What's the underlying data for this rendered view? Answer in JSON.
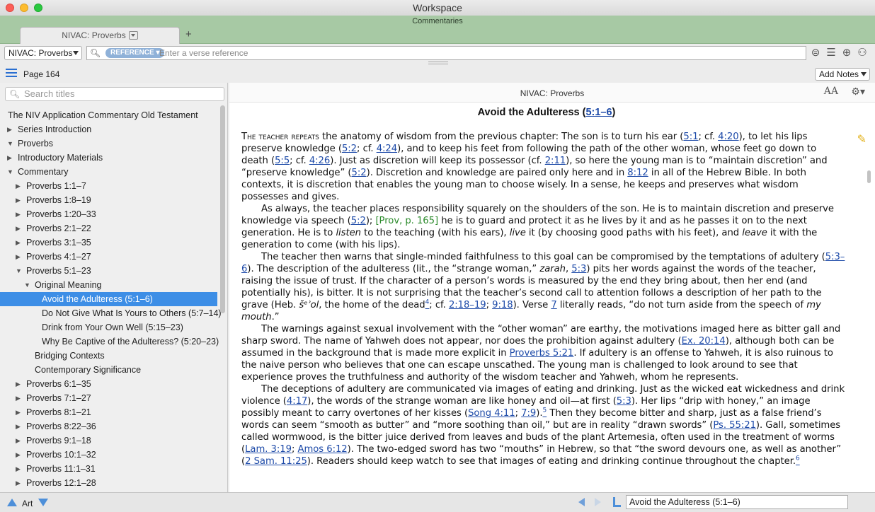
{
  "window": {
    "title": "Workspace"
  },
  "panel": {
    "title": "Commentaries",
    "tab_label": "NIVAC: Proverbs",
    "add_tab": "+"
  },
  "toolbar": {
    "resource": "NIVAC: Proverbs",
    "reference_pill": "REFERENCE ▾",
    "search_placeholder": "Enter a verse reference",
    "icons": [
      "search-options-icon",
      "list-icon",
      "add-icon",
      "people-icon"
    ]
  },
  "pagebar": {
    "page": "Page 164",
    "add_notes": "Add Notes"
  },
  "sidebar": {
    "search_placeholder": "Search titles",
    "items": [
      {
        "label": "The NIV Application Commentary Old Testament",
        "level": 0,
        "toggle": ""
      },
      {
        "label": "Series Introduction",
        "level": 1,
        "toggle": "▶"
      },
      {
        "label": "Proverbs",
        "level": 1,
        "toggle": "▼"
      },
      {
        "label": "Introductory Materials",
        "level": 2,
        "toggle": "▶"
      },
      {
        "label": "Commentary",
        "level": 2,
        "toggle": "▼"
      },
      {
        "label": "Proverbs 1:1–7",
        "level": 3,
        "toggle": "▶"
      },
      {
        "label": "Proverbs 1:8–19",
        "level": 3,
        "toggle": "▶"
      },
      {
        "label": "Proverbs 1:20–33",
        "level": 3,
        "toggle": "▶"
      },
      {
        "label": "Proverbs 2:1–22",
        "level": 3,
        "toggle": "▶"
      },
      {
        "label": "Proverbs 3:1–35",
        "level": 3,
        "toggle": "▶"
      },
      {
        "label": "Proverbs 4:1–27",
        "level": 3,
        "toggle": "▶"
      },
      {
        "label": "Proverbs 5:1–23",
        "level": 3,
        "toggle": "▼"
      },
      {
        "label": "Original Meaning",
        "level": 4,
        "toggle": "▼"
      },
      {
        "label": "Avoid the Adulteress (5:1–6)",
        "level": 5,
        "toggle": "",
        "selected": true
      },
      {
        "label": "Do Not Give What Is Yours to Others (5:7–14)",
        "level": 5,
        "toggle": ""
      },
      {
        "label": "Drink from Your Own Well (5:15–23)",
        "level": 5,
        "toggle": ""
      },
      {
        "label": "Why Be Captive of the Adulteress?  (5:20–23)",
        "level": 5,
        "toggle": ""
      },
      {
        "label": "Bridging Contexts",
        "level": 4,
        "toggle": ""
      },
      {
        "label": "Contemporary Significance",
        "level": 4,
        "toggle": ""
      },
      {
        "label": "Proverbs 6:1–35",
        "level": 3,
        "toggle": "▶"
      },
      {
        "label": "Proverbs 7:1–27",
        "level": 3,
        "toggle": "▶"
      },
      {
        "label": "Proverbs 8:1–21",
        "level": 3,
        "toggle": "▶"
      },
      {
        "label": "Proverbs 8:22–36",
        "level": 3,
        "toggle": "▶"
      },
      {
        "label": "Proverbs 9:1–18",
        "level": 3,
        "toggle": "▶"
      },
      {
        "label": "Proverbs 10:1–32",
        "level": 3,
        "toggle": "▶"
      },
      {
        "label": "Proverbs 11:1–31",
        "level": 3,
        "toggle": "▶"
      },
      {
        "label": "Proverbs 12:1–28",
        "level": 3,
        "toggle": "▶"
      }
    ]
  },
  "content": {
    "resource_name": "NIVAC: Proverbs",
    "font_size_icon": "AA",
    "heading_text": "Avoid the Adulteress (",
    "heading_ref": "5:1–6",
    "heading_close": ")",
    "paragraphs": [
      [
        {
          "t": "The teacher repeats",
          "c": "sc"
        },
        {
          "t": " the anatomy of wisdom from the previous chapter: The son is to turn his ear ("
        },
        {
          "t": "5:1",
          "c": "ref"
        },
        {
          "t": "; cf. "
        },
        {
          "t": "4:20",
          "c": "ref"
        },
        {
          "t": "), to let his lips preserve knowledge ("
        },
        {
          "t": "5:2",
          "c": "ref"
        },
        {
          "t": "; cf. "
        },
        {
          "t": "4:24",
          "c": "ref"
        },
        {
          "t": "), and to keep his feet from following the path of the other woman, whose feet go down to death ("
        },
        {
          "t": "5:5",
          "c": "ref"
        },
        {
          "t": "; cf. "
        },
        {
          "t": "4:26",
          "c": "ref"
        },
        {
          "t": "). Just as discretion will keep its possessor (cf. "
        },
        {
          "t": "2:11",
          "c": "ref"
        },
        {
          "t": "), so here the young man is to “maintain discretion” and “preserve knowledge” ("
        },
        {
          "t": "5:2",
          "c": "ref"
        },
        {
          "t": "). Discretion and knowledge are paired only here and in "
        },
        {
          "t": "8:12",
          "c": "ref"
        },
        {
          "t": " in all of the Hebrew Bible. In both contexts, it is discretion that enables the young man to choose wisely. In a sense, he keeps and preserves what wisdom possesses and gives."
        }
      ],
      [
        {
          "t": "As always, the teacher places responsibility squarely on the shoulders of the son. He is to maintain discretion and preserve knowledge via speech ("
        },
        {
          "t": "5:2",
          "c": "ref"
        },
        {
          "t": "); "
        },
        {
          "t": "[Prov, p. 165]",
          "c": "green"
        },
        {
          "t": " he is to guard and protect it as he lives by it and as he passes it on to the next generation. He is to "
        },
        {
          "t": "listen",
          "c": "i"
        },
        {
          "t": " to the teaching (with his ears), "
        },
        {
          "t": "live",
          "c": "i"
        },
        {
          "t": " it (by choosing good paths with his feet), and "
        },
        {
          "t": "leave",
          "c": "i"
        },
        {
          "t": " it with the generation to come (with his lips)."
        }
      ],
      [
        {
          "t": "The teacher then warns that single-minded faithfulness to this goal can be compromised by the temptations of adultery ("
        },
        {
          "t": "5:3–6",
          "c": "ref"
        },
        {
          "t": "). The description of the adulteress (lit., the “strange woman,” "
        },
        {
          "t": "zarah",
          "c": "i"
        },
        {
          "t": ", "
        },
        {
          "t": "5:3",
          "c": "ref"
        },
        {
          "t": ") pits her words against the words of the teacher, raising the issue of trust. If the character of a person’s words is measured by the end they bring about, then her end (and potentially his), is bitter. It is not surprising that the teacher’s second call to attention follows a description of her path to the grave (Heb. "
        },
        {
          "t": "šᵉʾol",
          "c": "i"
        },
        {
          "t": ", the home of the dead"
        },
        {
          "t": "4",
          "c": "supref"
        },
        {
          "t": "; cf. "
        },
        {
          "t": "2:18–19",
          "c": "ref"
        },
        {
          "t": "; "
        },
        {
          "t": "9:18",
          "c": "ref"
        },
        {
          "t": "). Verse "
        },
        {
          "t": "7",
          "c": "ref"
        },
        {
          "t": " literally reads, “do not turn aside from the speech of "
        },
        {
          "t": "my mouth",
          "c": "i"
        },
        {
          "t": ".”"
        }
      ],
      [
        {
          "t": "The warnings against sexual involvement with the “other woman” are earthy, the motivations imaged here as bitter gall and sharp sword. The name of Yahweh does not appear, nor does the prohibition against adultery ("
        },
        {
          "t": "Ex. 20:14",
          "c": "ref"
        },
        {
          "t": "), although both can be assumed in the background that is made more explicit in "
        },
        {
          "t": "Proverbs 5:21",
          "c": "ref"
        },
        {
          "t": ". If adultery is an offense to Yahweh, it is also ruinous to the naive person who believes that one can escape unscathed. The young man is challenged to look around to see that experience proves the truthfulness and authority of the wisdom teacher and Yahweh, whom he represents."
        }
      ],
      [
        {
          "t": "The deceptions of adultery are communicated via images of eating and drinking. Just as the wicked eat wickedness and drink violence ("
        },
        {
          "t": "4:17",
          "c": "ref"
        },
        {
          "t": "), the words of the strange woman are like honey and oil—at first ("
        },
        {
          "t": "5:3",
          "c": "ref"
        },
        {
          "t": "). Her lips “drip with honey,” an image possibly meant to carry overtones of her kisses ("
        },
        {
          "t": "Song 4:11",
          "c": "ref"
        },
        {
          "t": "; "
        },
        {
          "t": "7:9",
          "c": "ref"
        },
        {
          "t": ")."
        },
        {
          "t": "5",
          "c": "supref"
        },
        {
          "t": " Then they become bitter and sharp, just as a false friend’s words can seem “smooth as butter” and “more soothing than oil,” but are in reality “drawn swords” ("
        },
        {
          "t": "Ps. 55:21",
          "c": "ref"
        },
        {
          "t": "). Gall, sometimes called wormwood, is the bitter juice derived from leaves and buds of the plant Artemesia, often used in the treatment of worms ("
        },
        {
          "t": "Lam. 3:19",
          "c": "ref"
        },
        {
          "t": "; "
        },
        {
          "t": "Amos 6:12",
          "c": "ref"
        },
        {
          "t": "). The two-edged sword has two “mouths” in Hebrew, so that “the sword devours one, as well as another” ("
        },
        {
          "t": "2 Sam. 11:25",
          "c": "ref"
        },
        {
          "t": "). Readers should keep watch to see that images of eating and drinking continue throughout the chapter."
        },
        {
          "t": "6",
          "c": "supref"
        }
      ]
    ]
  },
  "statusbar": {
    "art_label": "Art",
    "location": "Avoid the Adulteress (5:1–6)"
  }
}
